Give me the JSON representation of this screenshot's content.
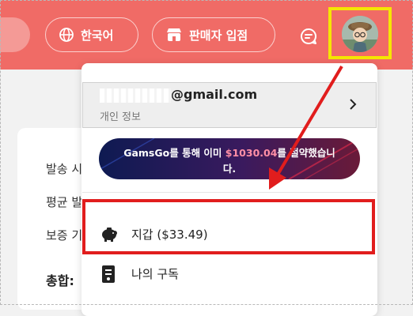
{
  "header": {
    "language_label": "한국어",
    "seller_label": "판매자 입점"
  },
  "icons": {
    "language": "globe-icon",
    "seller": "store-icon",
    "chat": "chat-icon",
    "avatar": "avatar-image",
    "wallet": "piggy-bank-icon",
    "subscription": "subscription-card-icon",
    "chevron": "chevron-right-icon"
  },
  "dropdown": {
    "email_visible": "@gmail.com",
    "personal_info_label": "개인 정보",
    "banner": {
      "prefix": "GamsGo를 통해 이미 ",
      "amount": "$1030.04",
      "suffix": "를 절약했습니",
      "line2": "다."
    },
    "menu": [
      {
        "label": "지갑 ($33.49)"
      },
      {
        "label": "나의 구독"
      }
    ]
  },
  "background": {
    "labels": [
      "발송 시",
      "평균 발",
      "보증 기"
    ],
    "total_label": "총합:"
  },
  "colors": {
    "header": "#f06b66",
    "highlight_yellow": "#f5e600",
    "highlight_red": "#e11d1d",
    "banner_amount": "#ff8fa6"
  }
}
